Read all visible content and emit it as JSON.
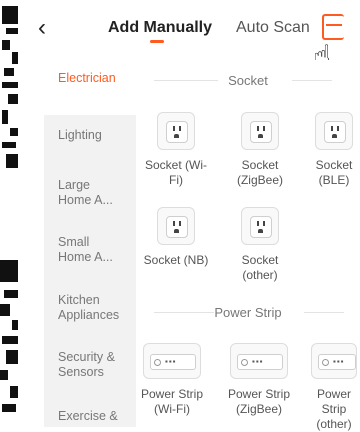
{
  "header": {
    "back_icon": "chevron-left-icon",
    "tabs": [
      {
        "label": "Add Manually",
        "active": true
      },
      {
        "label": "Auto Scan",
        "active": false
      }
    ],
    "scan_icon": "scan-icon",
    "accent_color": "#ff5a1f"
  },
  "sidebar": {
    "items": [
      {
        "label": "Electrician",
        "active": true
      },
      {
        "label": "Lighting"
      },
      {
        "label": "Large Home A..."
      },
      {
        "label": "Small Home A..."
      },
      {
        "label": "Kitchen Appliances"
      },
      {
        "label": "Security & Sensors"
      },
      {
        "label": "Exercise &"
      }
    ]
  },
  "sections": [
    {
      "title": "Socket",
      "devices": [
        {
          "label": "Socket (Wi-Fi)"
        },
        {
          "label": "Socket (ZigBee)"
        },
        {
          "label": "Socket (BLE)"
        },
        {
          "label": "Socket (NB)"
        },
        {
          "label": "Socket (other)"
        }
      ]
    },
    {
      "title": "Power Strip",
      "devices": [
        {
          "label": "Power Strip (Wi-Fi)"
        },
        {
          "label": "Power Strip (ZigBee)"
        },
        {
          "label": "Power Strip (other)"
        }
      ]
    }
  ]
}
